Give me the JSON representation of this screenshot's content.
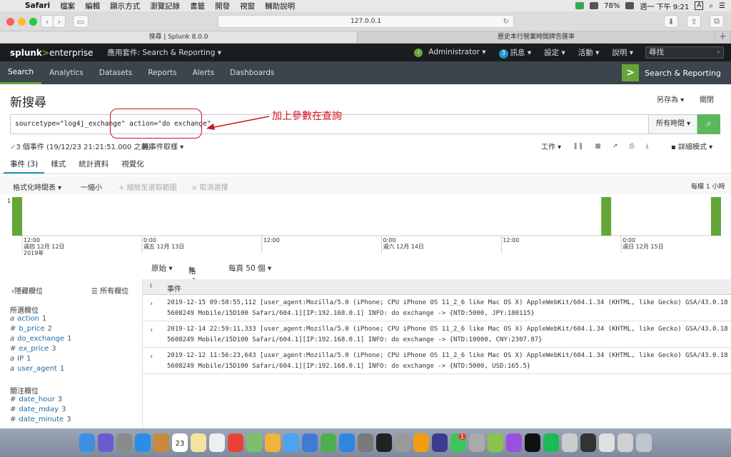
{
  "menubar": {
    "app": "Safari",
    "items": [
      "檔案",
      "編輯",
      "顯示方式",
      "瀏覽記錄",
      "書籤",
      "開發",
      "視窗",
      "輔助說明"
    ],
    "battery": "78%",
    "clock": "週一 下午 9:21",
    "input_indicator": "A"
  },
  "browser": {
    "url": "127.0.0.1",
    "tabs": [
      {
        "label": "搜尋 | Splunk 8.0.0",
        "active": true
      },
      {
        "label": "歷史本行營業時間牌告匯率",
        "active": false
      }
    ]
  },
  "topbar": {
    "logo_a": "splunk",
    "logo_gt": ">",
    "logo_b": "enterprise",
    "app_menu": "應用套件: Search & Reporting ▾",
    "user": "Administrator ▾",
    "messages_count": "3",
    "messages": "訊息 ▾",
    "settings": "設定 ▾",
    "activity": "活動 ▾",
    "help": "說明 ▾",
    "find": "尋找"
  },
  "appbar": {
    "items": [
      "Search",
      "Analytics",
      "Datasets",
      "Reports",
      "Alerts",
      "Dashboards"
    ],
    "active_index": 0,
    "app_label": "Search & Reporting"
  },
  "search": {
    "title": "新搜尋",
    "save_as": "另存為 ▾",
    "close": "關閉",
    "query": "sourcetype=\"log4j_exchange\" action=\"do exchange\"",
    "time_range": "所有時間 ▾",
    "annotation": "加上參數在查詢",
    "event_count": "3 個事件 (19/12/23 21:21:51.000 之前)",
    "sampling": "無事件取樣 ▾",
    "job": "工作 ▾",
    "mode": "詳細模式 ▾"
  },
  "result_tabs": [
    "事件 (3)",
    "樣式",
    "統計資料",
    "視覺化"
  ],
  "timeline_bar": {
    "format": "格式化時間表 ▾",
    "zoom_out": "一縮小",
    "zoom_sel": "+ 縮放至選取範圍",
    "deselect": "× 取消選擇",
    "per": "每欄 1 小時"
  },
  "chart_data": {
    "type": "bar",
    "y_label_top": "1",
    "x_tick_labels": [
      [
        "12:00",
        "週四 12月 12日",
        "2019年"
      ],
      [
        "0:00",
        "週五 12月 13日",
        ""
      ],
      [
        "12:00",
        "",
        ""
      ],
      [
        "0:00",
        "週六 12月 14日",
        ""
      ],
      [
        "12:00",
        "",
        ""
      ],
      [
        "0:00",
        "週日 12月 15日",
        ""
      ]
    ],
    "bars": [
      {
        "start": "2019-12-12 11:00",
        "end": "2019-12-12 12:00",
        "value": 1
      },
      {
        "start": "2019-12-14 22:00",
        "end": "2019-12-14 23:00",
        "value": 1
      },
      {
        "start": "2019-12-15 09:00",
        "end": "2019-12-15 10:00",
        "value": 1
      }
    ],
    "x_range": [
      "2019-12-12 11:00",
      "2019-12-15 10:00"
    ],
    "ylim": [
      0,
      1
    ],
    "color": "#65a637"
  },
  "controls": {
    "raw": "原始 ▾",
    "format": "格式",
    "per_page": "每頁 50 個 ▾"
  },
  "sidebar": {
    "hide_fields": "隱藏欄位",
    "all_fields": "所有欄位",
    "selected_title": "所選欄位",
    "selected": [
      {
        "type": "a",
        "name": "action",
        "count": "1"
      },
      {
        "type": "#",
        "name": "b_price",
        "count": "2"
      },
      {
        "type": "a",
        "name": "do_exchange",
        "count": "1"
      },
      {
        "type": "#",
        "name": "ex_price",
        "count": "3"
      },
      {
        "type": "a",
        "name": "IP",
        "count": "1"
      },
      {
        "type": "a",
        "name": "user_agent",
        "count": "1"
      }
    ],
    "interesting_title": "關注欄位",
    "interesting": [
      {
        "type": "#",
        "name": "date_hour",
        "count": "3"
      },
      {
        "type": "#",
        "name": "date_mday",
        "count": "3"
      },
      {
        "type": "#",
        "name": "date_minute",
        "count": "3"
      }
    ]
  },
  "events": {
    "header_i": "i",
    "header": "事件",
    "rows": [
      "2019-12-15 09:58:55,112 [user_agent:Mozilla/5.0 (iPhone; CPU iPhone OS 11_2_6 like Mac OS X) AppleWebKit/604.1.34 (KHTML, like Gecko) GSA/43.0.185608249 Mobile/15D100 Safari/604.1][IP:192.168.0.1] INFO: do exchange -> {NTD:5000, JPY:180115}",
      "2019-12-14 22:59:11,333 [user_agent:Mozilla/5.0 (iPhone; CPU iPhone OS 11_2_6 like Mac OS X) AppleWebKit/604.1.34 (KHTML, like Gecko) GSA/43.0.185608249 Mobile/15D100 Safari/604.1][IP:192.168.0.1] INFO: do exchange -> {NTD:10000, CNY:2307.87}",
      "2019-12-12 11:56:23,643 [user_agent:Mozilla/5.0 (iPhone; CPU iPhone OS 11_2_6 like Mac OS X) AppleWebKit/604.1.34 (KHTML, like Gecko) GSA/43.0.185608249 Mobile/15D100 Safari/604.1][IP:192.168.0.1] INFO: do exchange -> {NTD:5000, USD:165.5}"
    ]
  },
  "dock": {
    "calendar_day": "23",
    "line_badge": "1"
  }
}
